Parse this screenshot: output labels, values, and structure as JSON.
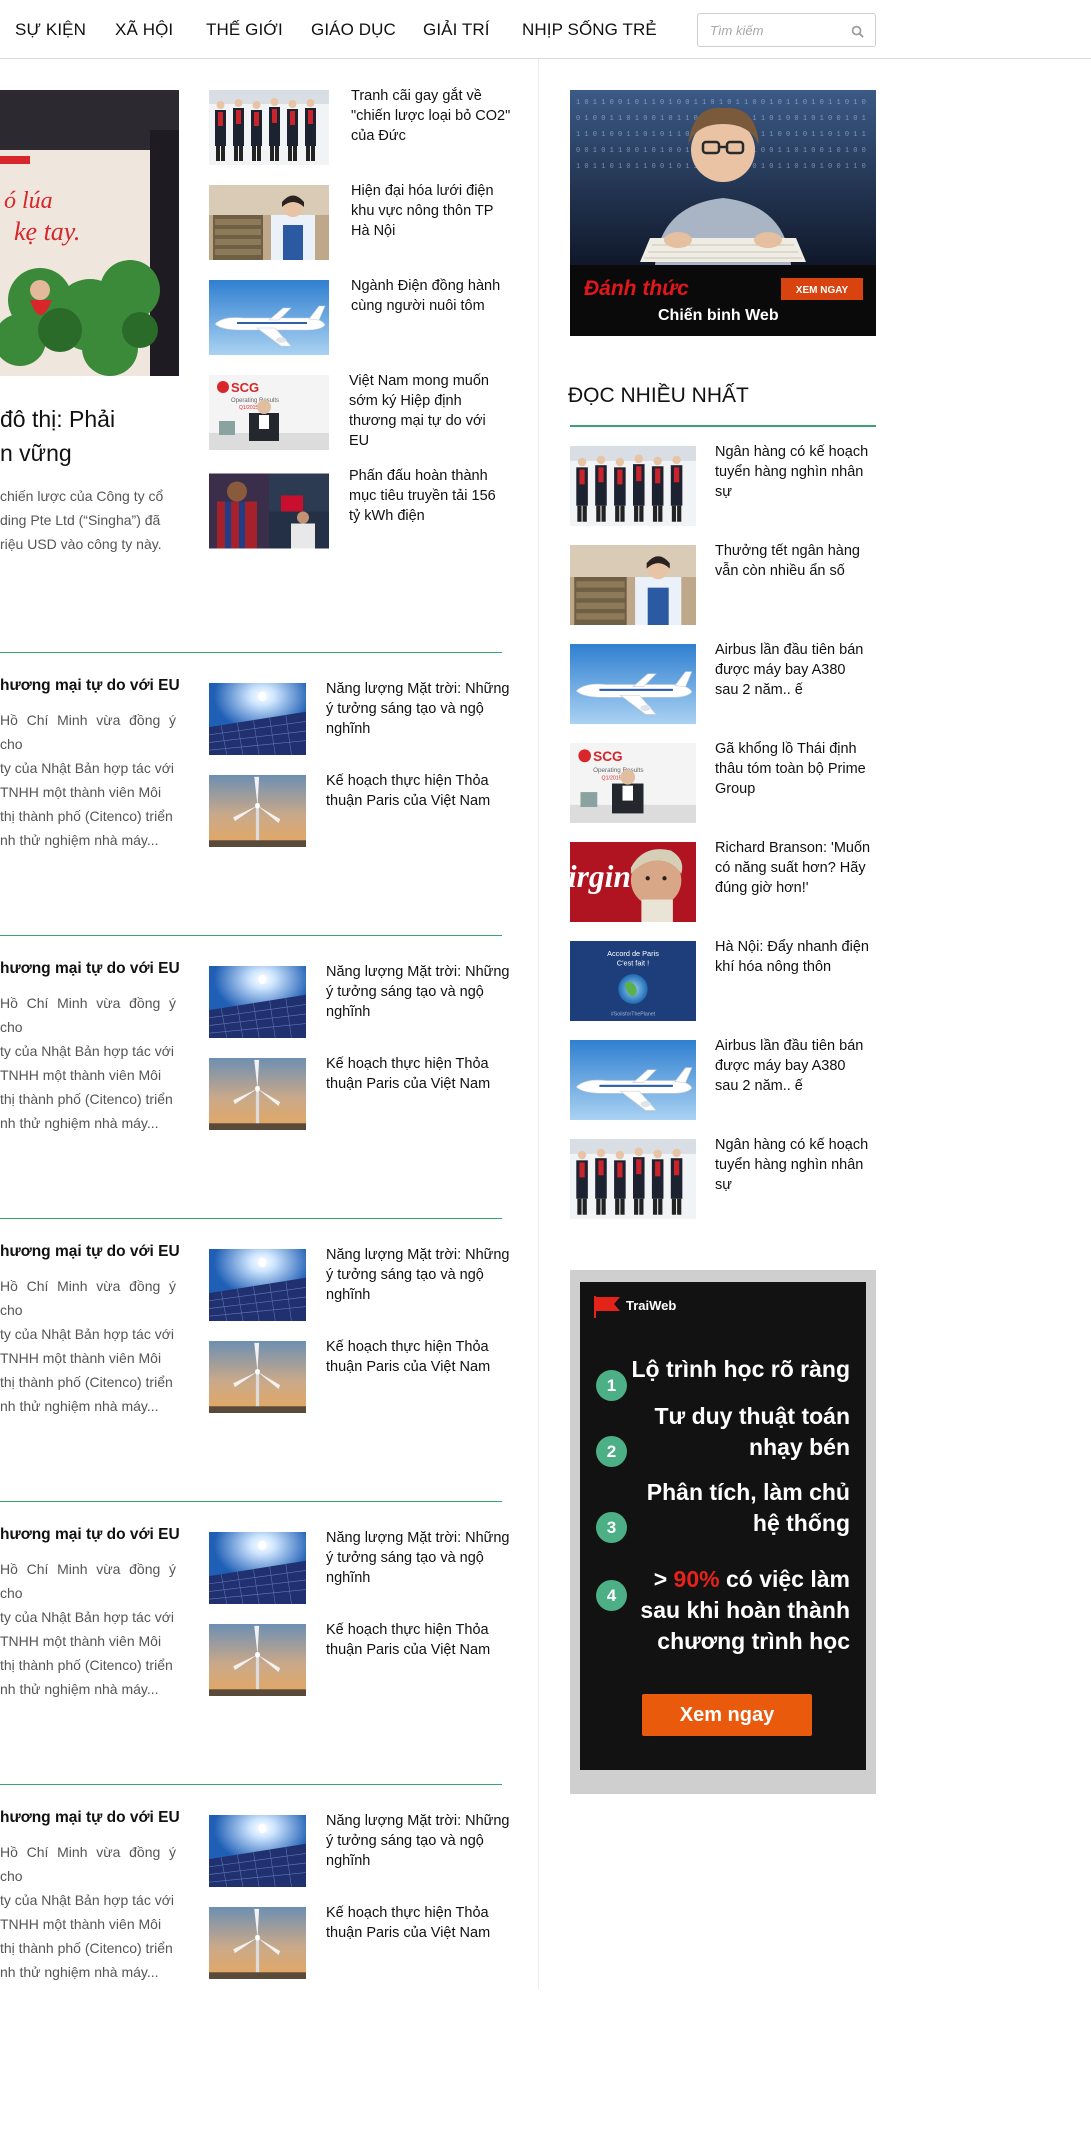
{
  "nav": {
    "items": [
      "SỰ KIỆN",
      "XÃ HỘI",
      "THẾ GIỚI",
      "GIÁO DỤC",
      "GIẢI TRÍ",
      "NHỊP SỐNG TRẺ"
    ],
    "search_placeholder": "Tìm kiếm",
    "search_icon": "search-icon"
  },
  "feature": {
    "title_line1": "đô thị: Phải",
    "title_line2": "n vững",
    "excerpt_lines": [
      "chiến lược của Công ty cổ",
      "ding Pte Ltd (“Singha”) đã",
      "riệu USD vào công ty này."
    ],
    "image_text_line1": "ó lúa",
    "image_text_line2": "kẹ tay."
  },
  "top_news": [
    {
      "title": "Tranh cãi gay gắt về \"chiến lược loại bỏ CO2\" của Đức",
      "image": "business-people"
    },
    {
      "title": "Hiện đại hóa lưới điện khu vực nông thôn TP Hà Nội",
      "image": "bank-teller"
    },
    {
      "title": "Ngành Điện đồng hành cùng người nuôi tôm",
      "image": "airplane"
    },
    {
      "title": "Việt Nam mong muốn sớm ký Hiệp định thương mại tự do với EU",
      "image": "scg-press"
    },
    {
      "title": "Phấn đấu hoàn thành mục tiêu truyền tải 156 tỷ kWh điện",
      "image": "footballers"
    }
  ],
  "story_block": {
    "headline": "hương mại tự do với EU",
    "excerpt_lines": [
      "Hồ Chí Minh vừa đồng ý cho",
      "ty của Nhật Bản hợp tác với",
      "TNHH một thành viên Môi",
      "thị thành phố (Citenco) triển",
      "nh thử nghiệm nhà máy..."
    ],
    "related": [
      {
        "title": "Năng lượng Mặt trời: Những ý tưởng sáng tạo và ngộ nghĩnh",
        "image": "solar-panel"
      },
      {
        "title": "Kế hoạch thực hiện Thỏa thuận Paris của Việt Nam",
        "image": "wind-turbine"
      }
    ]
  },
  "most_read": {
    "heading": "ĐỌC NHIỀU NHẤT",
    "items": [
      {
        "title": "Ngân hàng có kế hoạch tuyển hàng nghìn nhân sự",
        "image": "business-people"
      },
      {
        "title": "Thưởng tết ngân hàng vẫn còn nhiều ẩn số",
        "image": "bank-teller"
      },
      {
        "title": "Airbus lần đầu tiên bán được máy bay A380 sau 2 năm.. ế",
        "image": "airplane"
      },
      {
        "title": "Gã khổng lồ Thái định thâu tóm toàn bộ Prime Group",
        "image": "scg-press"
      },
      {
        "title": "Richard Branson: 'Muốn có năng suất hơn? Hãy đúng giờ hơn!'",
        "image": "branson"
      },
      {
        "title": "Hà Nội: Đẩy nhanh điện khí hóa nông thôn",
        "image": "paris-accord"
      },
      {
        "title": "Airbus lần đầu tiên bán được máy bay A380 sau 2 năm.. ế",
        "image": "airplane"
      },
      {
        "title": "Ngân hàng có kế hoạch tuyển hàng nghìn nhân sự",
        "image": "business-people"
      }
    ]
  },
  "ad_top": {
    "headline": "Đánh thức",
    "subline": "Chiến binh Web",
    "button": "XEM NGAY"
  },
  "ad_bottom": {
    "brand": "TraiWeb",
    "steps": [
      {
        "num": "1",
        "lines": [
          "Lộ trình học rõ ràng"
        ]
      },
      {
        "num": "2",
        "lines": [
          "Tư duy thuật toán",
          "nhạy bén"
        ]
      },
      {
        "num": "3",
        "lines": [
          "Phân tích, làm chủ",
          "hệ thống"
        ]
      },
      {
        "num": "4",
        "prefix": "> ",
        "highlight": "90%",
        "lines": [
          " có việc làm",
          "sau khi hoàn thành",
          "chương trình học"
        ]
      }
    ],
    "button": "Xem ngay",
    "highlight_color": "#e8211b"
  },
  "colors": {
    "accent": "#3aa374",
    "button": "#ea5a0c"
  }
}
